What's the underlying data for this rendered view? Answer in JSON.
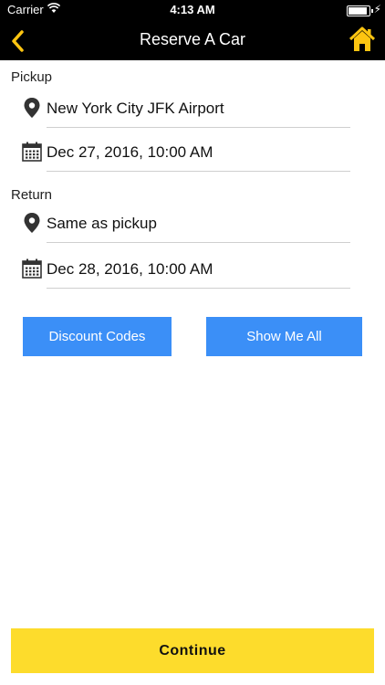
{
  "status_bar": {
    "carrier": "Carrier",
    "time": "4:13 AM"
  },
  "nav": {
    "title": "Reserve A Car",
    "back_icon": "chevron-left-icon",
    "home_icon": "home-icon",
    "accent": "#fdc511"
  },
  "pickup": {
    "label": "Pickup",
    "location": "New York City JFK Airport",
    "datetime": "Dec 27, 2016, 10:00 AM"
  },
  "return": {
    "label": "Return",
    "location": "Same as pickup",
    "datetime": "Dec 28, 2016, 10:00 AM"
  },
  "buttons": {
    "discount": "Discount Codes",
    "show_all": "Show Me All",
    "continue": "Continue"
  },
  "colors": {
    "blue": "#3b8ff7",
    "yellow": "#fddc2c",
    "bar": "#000000"
  }
}
